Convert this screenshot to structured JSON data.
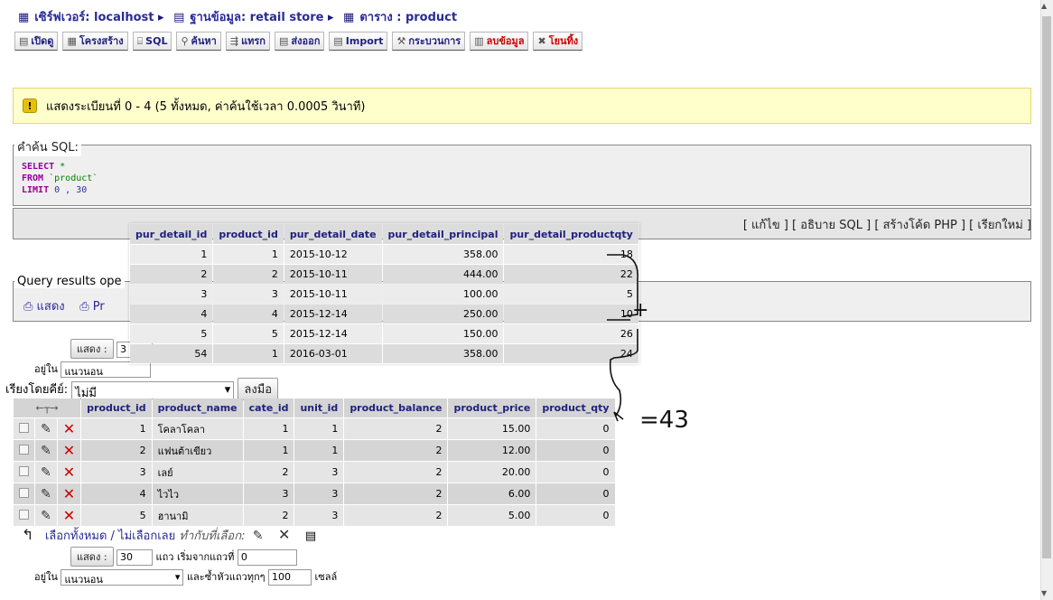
{
  "breadcrumb": {
    "server": "เซิร์ฟเวอร์: localhost",
    "database": "ฐานข้อมูล: retail store",
    "table": "ตาราง : product"
  },
  "tabs": [
    "เปิดดู",
    "โครงสร้าง",
    "SQL",
    "ค้นหา",
    "แทรก",
    "ส่งออก",
    "Import",
    "กระบวนการ",
    "ลบข้อมูล",
    "โยนทิ้ง"
  ],
  "notice": "แสดงระเบียนที่ 0 - 4 (5 ทั้งหมด, ค่าค้นใช้เวลา 0.0005 วินาที)",
  "sql_box": {
    "legend": "คำค้น SQL:",
    "select": "SELECT",
    "star": " *",
    "from": "FROM",
    "table": " `product`",
    "limit": "LIMIT",
    "limit_vals": " 0 , 30"
  },
  "sql_links": "[ แก้ไข ] [ อธิบาย SQL ] [ สร้างโค้ด PHP ] [ เรียกใหม่ ]",
  "query_ops": {
    "legend": "Query results ope",
    "show": "แสดง",
    "print": "Pr"
  },
  "form1": {
    "show_btn": "แสดง :",
    "rows": "3",
    "in_label": "อยู่ใน",
    "mode": "แนวนอน"
  },
  "sort": {
    "label": "เรียงโดยคีย์:",
    "value": "ไม่มี",
    "go": "ลงมือ"
  },
  "main_table": {
    "headers": [
      "product_id",
      "product_name",
      "cate_id",
      "unit_id",
      "product_balance",
      "product_price",
      "product_qty"
    ],
    "rows": [
      [
        "1",
        "โคลาโคลา",
        "1",
        "1",
        "2",
        "15.00",
        "0"
      ],
      [
        "2",
        "แฟนต้าเขียว",
        "1",
        "1",
        "2",
        "12.00",
        "0"
      ],
      [
        "3",
        "เลย์",
        "2",
        "3",
        "2",
        "20.00",
        "0"
      ],
      [
        "4",
        "ไวไว",
        "3",
        "3",
        "2",
        "6.00",
        "0"
      ],
      [
        "5",
        "ฮานามิ",
        "2",
        "3",
        "2",
        "5.00",
        "0"
      ]
    ]
  },
  "overlay_table": {
    "headers": [
      "pur_detail_id",
      "product_id",
      "pur_detail_date",
      "pur_detail_principal",
      "pur_detail_productqty"
    ],
    "rows": [
      [
        "1",
        "1",
        "2015-10-12",
        "358.00",
        "18"
      ],
      [
        "2",
        "2",
        "2015-10-11",
        "444.00",
        "22"
      ],
      [
        "3",
        "3",
        "2015-10-11",
        "100.00",
        "5"
      ],
      [
        "4",
        "4",
        "2015-12-14",
        "250.00",
        "10"
      ],
      [
        "5",
        "5",
        "2015-12-14",
        "150.00",
        "26"
      ],
      [
        "54",
        "1",
        "2016-03-01",
        "358.00",
        "24"
      ]
    ]
  },
  "annotation": {
    "result": "=43",
    "plus": "+"
  },
  "bottom": {
    "check_all": "เลือกทั้งหมด / ไม่เลือกเลย",
    "with_selected": "ทำกับที่เลือก:"
  },
  "form2": {
    "show_btn": "แสดง :",
    "rows": "30",
    "start_label": "แถว เริ่มจากแถวที่",
    "start": "0",
    "in_label": "อยู่ใน",
    "mode": "แนวนอน",
    "repeat_label": "และซ้ำหัวแถวทุกๆ",
    "repeat": "100",
    "cells": "เซลล์"
  }
}
